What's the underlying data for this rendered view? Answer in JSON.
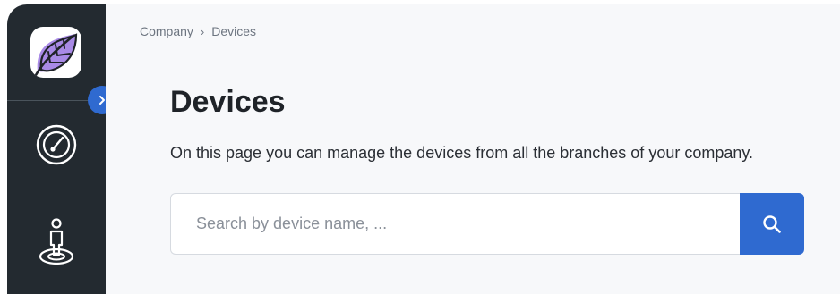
{
  "breadcrumb": {
    "items": [
      {
        "label": "Company"
      },
      {
        "label": "Devices"
      }
    ],
    "separator": "›"
  },
  "page": {
    "title": "Devices",
    "description": "On this page you can manage the devices from all the branches of your company."
  },
  "search": {
    "placeholder": "Search by device name, ...",
    "value": ""
  },
  "sidebar": {
    "items": [
      {
        "icon": "speedometer-icon"
      },
      {
        "icon": "user-location-icon"
      }
    ]
  },
  "icons": {
    "logo": "leaf-logo",
    "expand": "chevron-right-icon",
    "search": "search-icon"
  },
  "colors": {
    "sidebar_bg": "#232a30",
    "accent": "#2f6ad0",
    "logo_purple": "#a98ae6",
    "main_bg": "#f7f8fa"
  }
}
